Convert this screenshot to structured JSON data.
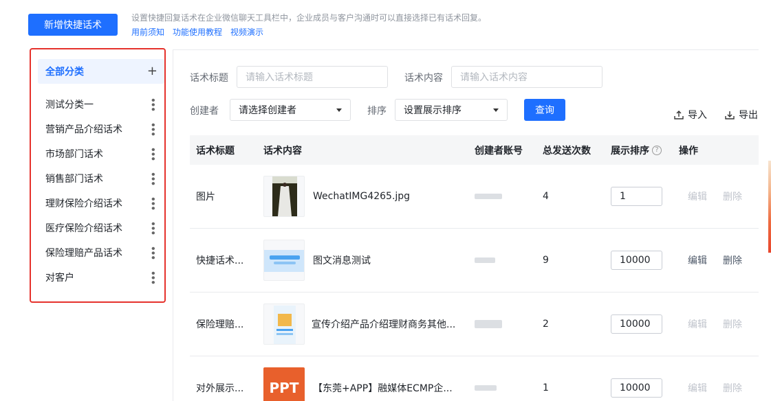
{
  "header": {
    "add_button": "新增快捷话术",
    "description": "设置快捷回复话术在企业微信聊天工具栏中，企业成员与客户沟通时可以直接选择已有话术回复。",
    "links": [
      "用前须知",
      "功能使用教程",
      "视频演示"
    ]
  },
  "sidebar": {
    "all_label": "全部分类",
    "add_icon": "plus-icon",
    "items": [
      {
        "label": "测试分类一"
      },
      {
        "label": "营销产品介绍话术"
      },
      {
        "label": "市场部门话术"
      },
      {
        "label": "销售部门话术"
      },
      {
        "label": "理财保险介绍话术"
      },
      {
        "label": "医疗保险介绍话术"
      },
      {
        "label": "保险理赔产品话术"
      },
      {
        "label": "对客户"
      }
    ]
  },
  "filters": {
    "title_label": "话术标题",
    "title_placeholder": "请输入话术标题",
    "content_label": "话术内容",
    "content_placeholder": "请输入话术内容",
    "creator_label": "创建者",
    "creator_value": "请选择创建者",
    "sort_label": "排序",
    "sort_value": "设置展示排序",
    "query_button": "查询",
    "import_label": "导入",
    "export_label": "导出"
  },
  "table": {
    "columns": [
      "话术标题",
      "话术内容",
      "创建者账号",
      "总发送次数",
      "展示排序",
      "操作"
    ],
    "rows": [
      {
        "title": "图片",
        "content": "WechatIMG4265.jpg",
        "sends": "4",
        "order": "1",
        "edit": "编辑",
        "delete": "删除",
        "actions_enabled": false
      },
      {
        "title": "快捷话术...",
        "content": "图文消息测试",
        "sends": "9",
        "order": "10000",
        "edit": "编辑",
        "delete": "删除",
        "actions_enabled": true
      },
      {
        "title": "保险理赔...",
        "content": "宣传介绍产品介绍理财商务其他...",
        "sends": "2",
        "order": "10000",
        "edit": "编辑",
        "delete": "删除",
        "actions_enabled": false
      },
      {
        "title": "对外展示...",
        "content": "【东莞+APP】融媒体ECMP企...",
        "sends": "1",
        "order": "10000",
        "edit": "编辑",
        "delete": "删除",
        "actions_enabled": false,
        "thumb_text": "PPT"
      }
    ]
  },
  "colors": {
    "primary": "#1e6fff",
    "highlight_border": "#e5312b"
  }
}
